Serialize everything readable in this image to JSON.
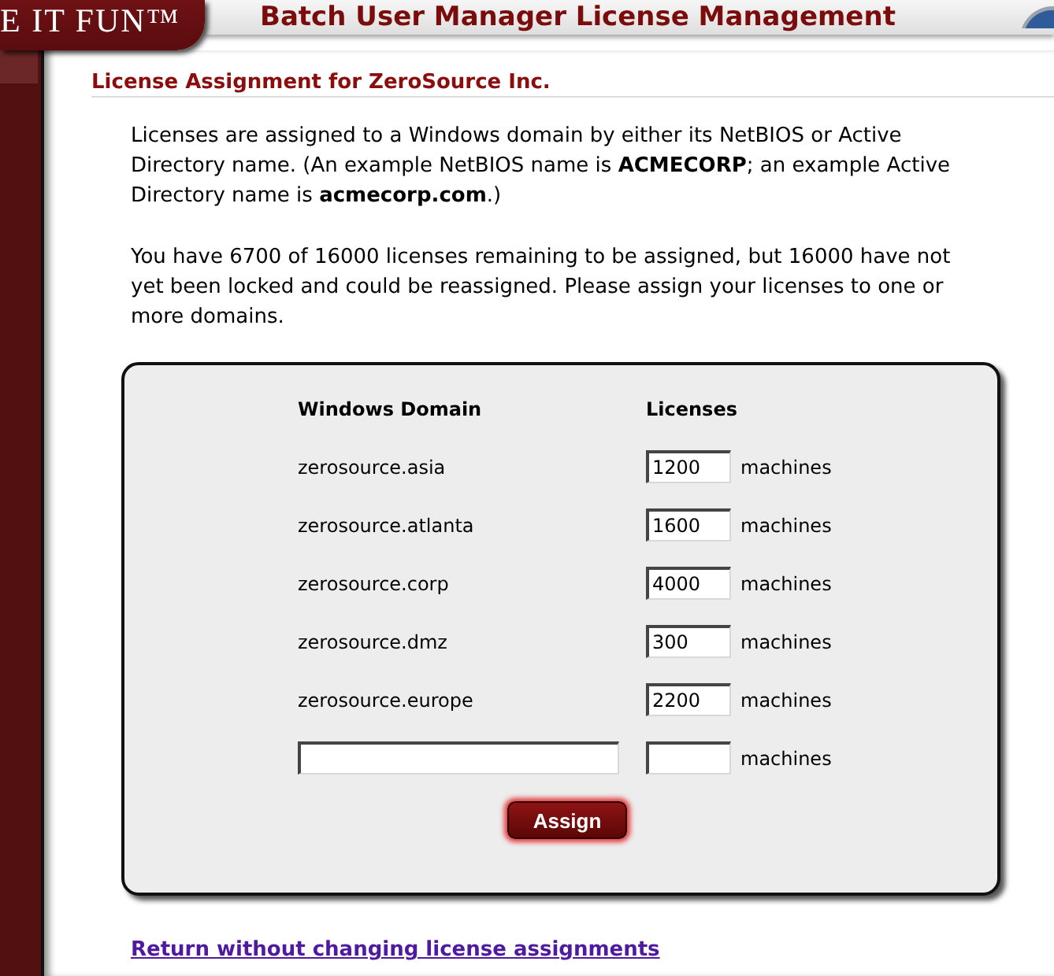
{
  "header": {
    "logo_text": "E IT FUN™",
    "title": "Batch User Manager License Management"
  },
  "section": {
    "heading": "License Assignment for ZeroSource Inc.",
    "paragraphs": [
      "Licenses are assigned to a Windows domain by either its NetBIOS or Active Directory name. (An example NetBIOS name is **ACMECORP**; an example Active Directory name is **acmecorp.com**.)",
      "You have 6700 of 16000 licenses remaining to be assigned, but 16000 have not yet been locked and could be reassigned. Please assign your licenses to one or more domains."
    ]
  },
  "form": {
    "columns": [
      "Windows Domain",
      "Licenses"
    ],
    "rows": [
      {
        "kind": "fixed",
        "domain": "zerosource.asia",
        "licenses": "1200",
        "unit": "machines"
      },
      {
        "kind": "fixed",
        "domain": "zerosource.atlanta",
        "licenses": "1600",
        "unit": "machines"
      },
      {
        "kind": "fixed",
        "domain": "zerosource.corp",
        "licenses": "4000",
        "unit": "machines"
      },
      {
        "kind": "fixed",
        "domain": "zerosource.dmz",
        "licenses": "300",
        "unit": "machines"
      },
      {
        "kind": "fixed",
        "domain": "zerosource.europe",
        "licenses": "2200",
        "unit": "machines"
      },
      {
        "kind": "new",
        "unit": "machines"
      }
    ],
    "button": "Assign"
  },
  "link": "Return without changing license assignments"
}
